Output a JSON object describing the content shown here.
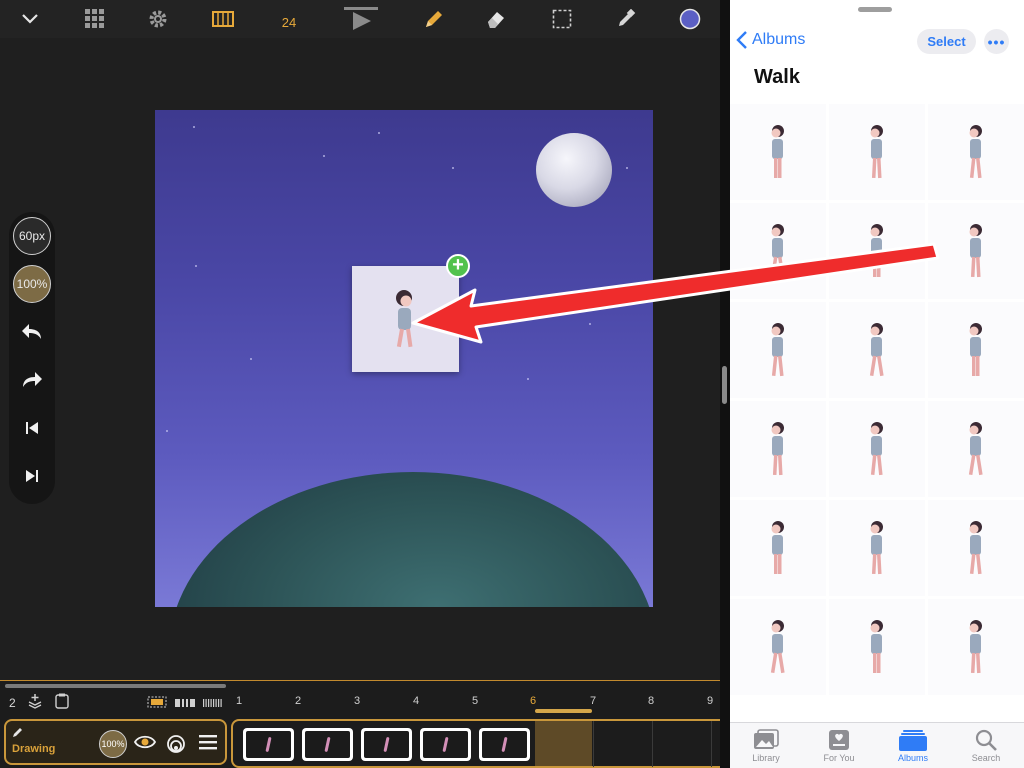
{
  "toolbar": {
    "fps": "24",
    "icons": [
      "collapse-chevron-icon",
      "grid-icon",
      "gear-icon",
      "filmstrip-icon",
      "play-icon",
      "pencil-icon",
      "eraser-icon",
      "lasso-select-icon",
      "eyedropper-icon",
      "color-swatch-icon"
    ],
    "color_swatch": "#5b5fc4"
  },
  "side_tools": {
    "brush_size": "60px",
    "brush_opacity": "100%"
  },
  "timeline": {
    "layer_count": "2",
    "layer_name": "Drawing",
    "layer_opacity": "100%",
    "frame_numbers": [
      "1",
      "2",
      "3",
      "4",
      "5",
      "6",
      "7",
      "8",
      "9"
    ],
    "current_frame": "6",
    "accent": "#c9973b"
  },
  "photos": {
    "back_label": "Albums",
    "select_label": "Select",
    "more_label": "•••",
    "album_title": "Walk",
    "tabs": [
      {
        "label": "Library",
        "icon": "photo-library-icon",
        "active": false
      },
      {
        "label": "For You",
        "icon": "for-you-icon",
        "active": false
      },
      {
        "label": "Albums",
        "icon": "albums-icon",
        "active": true
      },
      {
        "label": "Search",
        "icon": "search-icon",
        "active": false
      }
    ],
    "accent": "#2f7cf6"
  }
}
